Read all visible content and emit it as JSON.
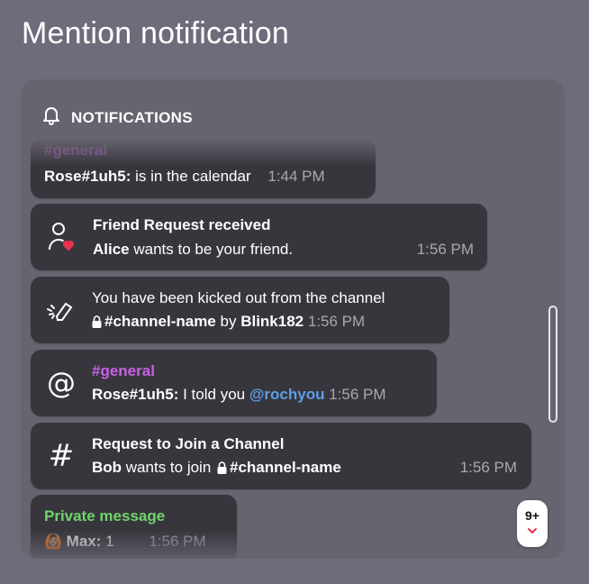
{
  "page": {
    "title": "Mention notification"
  },
  "panel": {
    "header": "NOTIFICATIONS",
    "scrollbar_visible": true
  },
  "colors": {
    "background": "#6f6b7b",
    "panel": "#67636f",
    "card": "#38363d",
    "channel_purple": "#c862e6",
    "mention_blue": "#5e9ee8",
    "private_green": "#6fd46b",
    "heart_red": "#e9334b",
    "badge_chevron": "#e9334b"
  },
  "notifications": [
    {
      "type": "channel-message",
      "channel": "#general",
      "user": "Rose#1uh5:",
      "text": "is in the calendar",
      "time": "1:44 PM",
      "partially_hidden": true
    },
    {
      "type": "friend-request",
      "icon": "user-heart-icon",
      "title": "Friend Request received",
      "user": "Alice",
      "text": "wants to be your friend.",
      "time": "1:56 PM"
    },
    {
      "type": "kicked",
      "icon": "kick-icon",
      "title": "You have been kicked out from the channel",
      "channel": "#channel-name",
      "by_word": "by",
      "by_user": "Blink182",
      "time": "1:56 PM"
    },
    {
      "type": "mention",
      "icon": "at-icon",
      "channel": "#general",
      "user": "Rose#1uh5:",
      "text": "I told you",
      "mention": "@rochyou",
      "time": "1:56 PM"
    },
    {
      "type": "join-request",
      "icon": "hash-icon",
      "title": "Request to Join a Channel",
      "user": "Bob",
      "text": "wants to join",
      "channel": "#channel-name",
      "time": "1:56 PM"
    },
    {
      "type": "private-message",
      "title": "Private message",
      "avatar_emoji": "🙆🏽",
      "user": "Max:",
      "text": "1",
      "time": "1:56 PM",
      "partially_hidden": true
    }
  ],
  "badge": {
    "count": "9+",
    "icon": "chevron-down-icon"
  }
}
